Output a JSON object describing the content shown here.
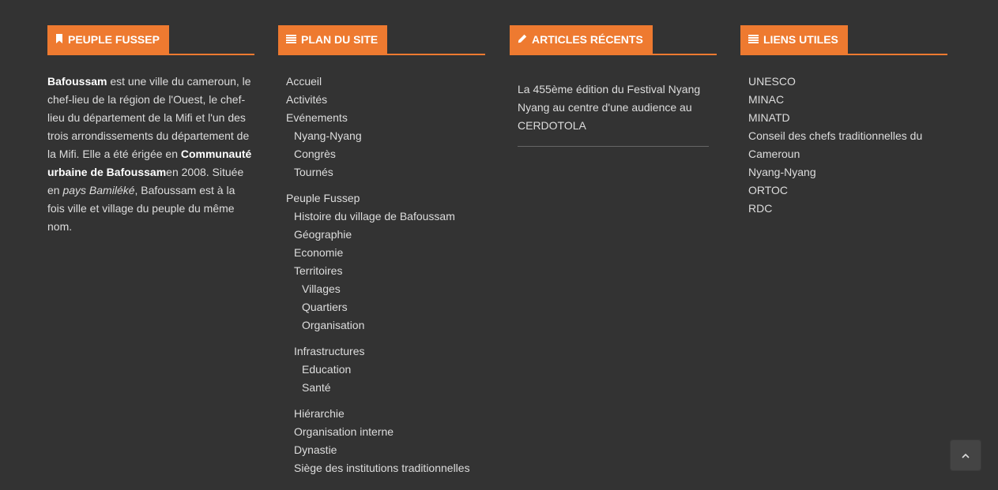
{
  "colors": {
    "background": "#333333",
    "accent": "#ee7a30",
    "text": "#dddddd"
  },
  "about": {
    "title": "PEUPLE FUSSEP",
    "icon": "bookmark-icon",
    "b1": "Bafoussam",
    "t1": " est une ville du cameroun, le chef-lieu de la région de l'Ouest, le chef-lieu du département de la Mifi et l'un des trois arrondissements du département de la Mifi. Elle a été érigée en ",
    "b2": "Communauté urbaine de Bafoussam",
    "t2": "en 2008. Située en ",
    "i1": "pays Bamiléké",
    "t3": ", Bafoussam est à la fois ville et village du peuple du même nom."
  },
  "sitemap": {
    "title": "PLAN DU SITE",
    "icon": "list-icon",
    "accueil": "Accueil",
    "activites": "Activités",
    "evenements": "Evénements",
    "nyang": "Nyang-Nyang",
    "congres": "Congrès",
    "tournes": "Tournés",
    "peuple": "Peuple Fussep",
    "histoire": "Histoire du village de Bafoussam",
    "geographie": "Géographie",
    "economie": "Economie",
    "territoires": "Territoires",
    "villages": "Villages",
    "quartiers": "Quartiers",
    "organisation": "Organisation",
    "infrastructures": "Infrastructures",
    "education": "Education",
    "sante": "Santé",
    "hierarchie": "Hiérarchie",
    "organisation_interne": "Organisation interne",
    "dynastie": "Dynastie",
    "siege": "Siège des institutions traditionnelles"
  },
  "recent": {
    "title": "ARTICLES RÉCENTS",
    "icon": "pencil-icon",
    "article1": "La 455ème édition du Festival Nyang Nyang au centre d'une audience au CERDOTOLA"
  },
  "links": {
    "title": "LIENS UTILES",
    "icon": "list-icon",
    "items": [
      "UNESCO",
      "MINAC",
      "MINATD",
      "Conseil des chefs traditionnelles du Cameroun",
      "Nyang-Nyang",
      "ORTOC",
      "RDC"
    ]
  },
  "scroll_top": {
    "icon": "chevron-up-icon"
  }
}
